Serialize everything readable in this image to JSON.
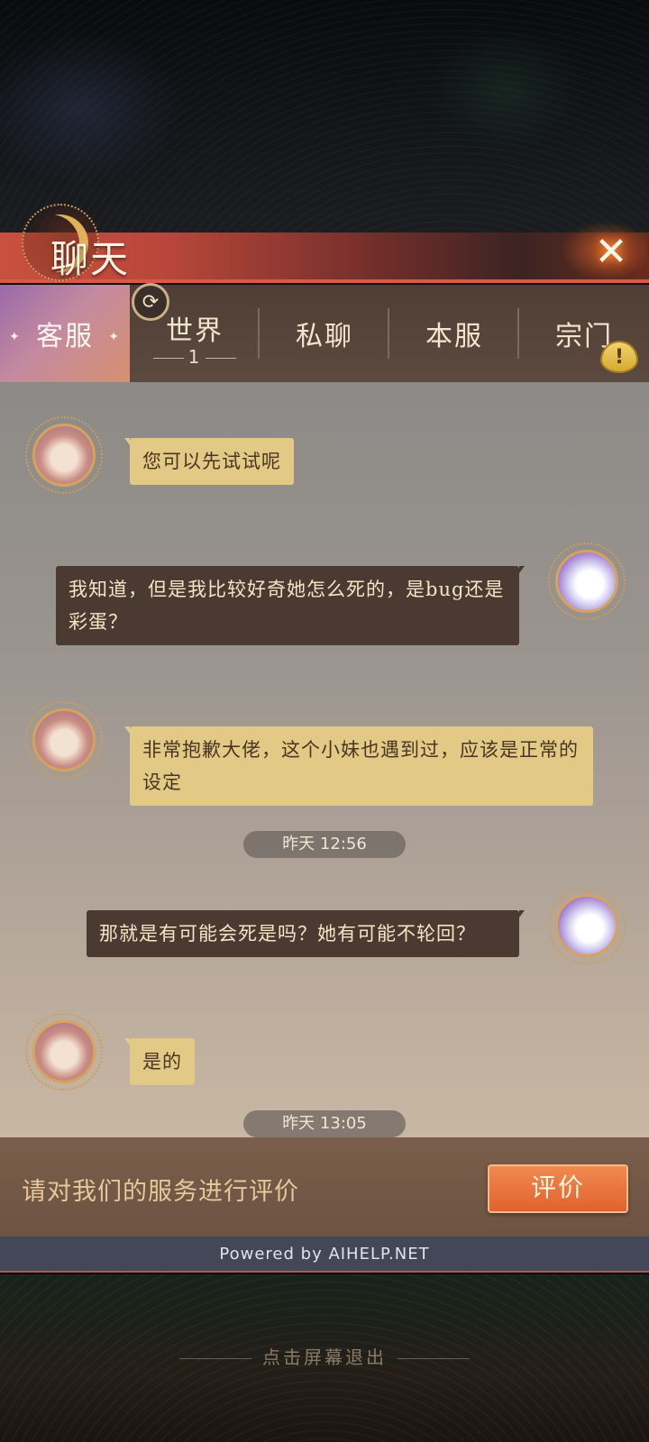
{
  "header": {
    "title": "聊天",
    "close_icon": "close-icon"
  },
  "tabs": [
    {
      "label": "客服",
      "active": true
    },
    {
      "label": "世界",
      "badge": "1"
    },
    {
      "label": "私聊"
    },
    {
      "label": "本服"
    },
    {
      "label": "宗门"
    }
  ],
  "messages": [
    {
      "sender": "agent",
      "text": "您可以先试试呢"
    },
    {
      "sender": "user",
      "text": "我知道，但是我比较好奇她怎么死的，是bug还是彩蛋？"
    },
    {
      "sender": "agent",
      "text": "非常抱歉大佬，这个小妹也遇到过，应该是正常的设定"
    },
    {
      "type": "time",
      "text": "昨天 12:56"
    },
    {
      "sender": "user",
      "text": "那就是有可能会死是吗？她有可能不轮回？"
    },
    {
      "sender": "agent",
      "text": "是的"
    },
    {
      "type": "time",
      "text": "昨天 13:05"
    }
  ],
  "rating": {
    "prompt": "请对我们的服务进行评价",
    "button_label": "评价"
  },
  "footer": {
    "powered_by": "Powered by AIHELP.NET",
    "exit_hint": "点击屏幕退出"
  },
  "icons": {
    "refresh": "refresh-icon",
    "alert": "alert-icon"
  },
  "colors": {
    "agent_bubble": "#e2c986",
    "user_bubble": "#4a3a31",
    "accent": "#e1622e"
  }
}
